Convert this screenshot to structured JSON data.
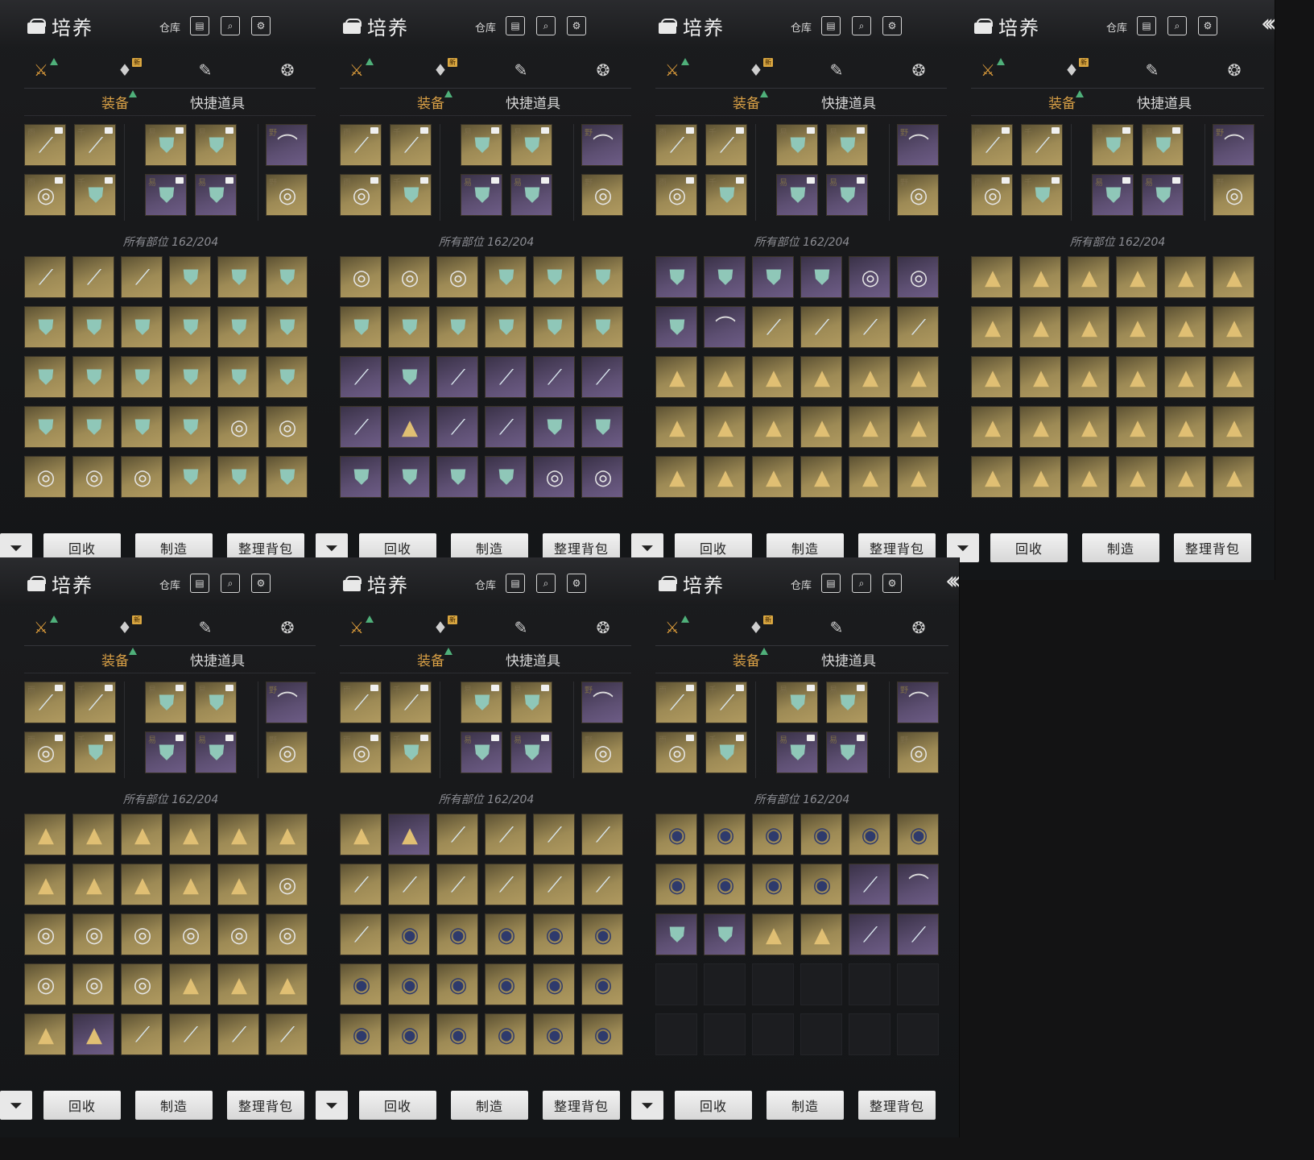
{
  "header": {
    "title": "培养",
    "warehouse_label": "仓库",
    "icons": [
      "bag-icon",
      "storage-icon",
      "search-icon",
      "settings-gear-icon",
      "back-arrow-icon"
    ]
  },
  "categories": [
    {
      "name": "equipment-category-icon",
      "glyph": "⚔",
      "active": true
    },
    {
      "name": "consumable-category-icon",
      "glyph": "♦",
      "badge": "新"
    },
    {
      "name": "scroll-category-icon",
      "glyph": "✎"
    },
    {
      "name": "misc-category-icon",
      "glyph": "❂"
    }
  ],
  "subtabs": {
    "equipment": "装备",
    "quick_items": "快捷道具"
  },
  "count_label": "所有部位 162/204",
  "bottom_bar": {
    "recycle": "回收",
    "craft": "制造",
    "organize": "整理背包"
  },
  "equipped": [
    {
      "type": "weapon",
      "quality": "gold",
      "char": "雨"
    },
    {
      "type": "weapon",
      "quality": "gold",
      "char": "千"
    },
    {
      "type": "armor",
      "quality": "gold",
      "char": "易"
    },
    {
      "type": "armor",
      "quality": "gold",
      "char": "易"
    },
    {
      "type": "bow",
      "quality": "purple",
      "char": "野"
    },
    {
      "type": "disc",
      "quality": "gold",
      "char": "雨"
    },
    {
      "type": "armor",
      "quality": "gold",
      "char": "千"
    },
    {
      "type": "armor",
      "quality": "purple",
      "char": "易"
    },
    {
      "type": "armor",
      "quality": "purple",
      "char": "易"
    },
    {
      "type": "disc",
      "quality": "gold",
      "char": "野"
    }
  ],
  "colors": {
    "accent": "#d9a046",
    "upgrade": "#4fb07a",
    "gold_slot": "#9d8a55",
    "purple_slot": "#5d4f72"
  },
  "panels": [
    {
      "id": "p1",
      "inventory": [
        "weapon:gold",
        "weapon:gold",
        "weapon:gold",
        "armor:gold",
        "armor:gold",
        "armor:gold",
        "armor:gold",
        "armor:gold",
        "armor:gold",
        "armor:gold",
        "armor:gold",
        "armor:gold",
        "armor:gold",
        "armor:gold",
        "armor:gold",
        "armor:gold",
        "armor:gold",
        "armor:gold",
        "armor:gold",
        "armor:gold",
        "armor:gold",
        "armor:gold",
        "disc:gold",
        "disc:gold",
        "disc:gold",
        "disc:gold",
        "disc:gold",
        "armor:gold",
        "armor:gold",
        "armor:gold"
      ]
    },
    {
      "id": "p2",
      "inventory": [
        "disc:gold",
        "disc:gold",
        "disc:gold",
        "armor:gold",
        "armor:gold",
        "armor:gold",
        "armor:gold",
        "armor:gold",
        "armor:gold",
        "armor:gold",
        "armor:gold",
        "armor:gold",
        "weapon:purple",
        "armor:purple",
        "weapon:purple",
        "weapon:purple",
        "weapon:purple",
        "weapon:purple",
        "weapon:purple",
        "gold:purple",
        "weapon:purple",
        "weapon:purple",
        "armor:purple",
        "armor:purple",
        "armor:purple",
        "armor:purple",
        "armor:purple",
        "armor:purple",
        "disc:purple",
        "disc:purple"
      ]
    },
    {
      "id": "p3",
      "inventory": [
        "armor:purple",
        "armor:purple",
        "armor:purple",
        "armor:purple",
        "disc:purple",
        "disc:purple",
        "armor:purple",
        "bow:purple",
        "weapon:gold",
        "weapon:gold",
        "weapon:gold",
        "weapon:gold",
        "gold:gold",
        "gold:gold",
        "gold:gold",
        "gold:gold",
        "gold:gold",
        "gold:gold",
        "gold:gold",
        "gold:gold",
        "gold:gold",
        "gold:gold",
        "gold:gold",
        "gold:gold",
        "gold:gold",
        "gold:gold",
        "gold:gold",
        "gold:gold",
        "gold:gold",
        "gold:gold"
      ]
    },
    {
      "id": "p4",
      "inventory": [
        "gold:gold",
        "gold:gold",
        "gold:gold",
        "gold:gold",
        "gold:gold",
        "gold:gold",
        "gold:gold",
        "gold:gold",
        "gold:gold",
        "gold:gold",
        "gold:gold",
        "gold:gold",
        "gold:gold",
        "gold:gold",
        "gold:gold",
        "gold:gold",
        "gold:gold",
        "gold:gold",
        "gold:gold",
        "gold:gold",
        "gold:gold",
        "gold:gold",
        "gold:gold",
        "gold:gold",
        "gold:gold",
        "gold:gold",
        "gold:gold",
        "gold:gold",
        "gold:gold",
        "gold:gold"
      ]
    },
    {
      "id": "p5",
      "inventory": [
        "gold:gold",
        "gold:gold",
        "gold:gold",
        "gold:gold",
        "gold:gold",
        "gold:gold",
        "gold:gold",
        "gold:gold",
        "gold:gold",
        "gold:gold",
        "gold:gold",
        "disc:gold",
        "disc:gold",
        "disc:gold",
        "disc:gold",
        "disc:gold",
        "disc:gold",
        "disc:gold",
        "disc:gold",
        "disc:gold",
        "disc:gold",
        "gold:gold",
        "gold:gold",
        "gold:gold",
        "gold:gold",
        "gold:purple",
        "weapon:gold",
        "weapon:gold",
        "weapon:gold",
        "weapon:gold"
      ]
    },
    {
      "id": "p6",
      "inventory": [
        "gold:gold",
        "gold:purple",
        "weapon:gold",
        "weapon:gold",
        "weapon:gold",
        "weapon:gold",
        "weapon:gold",
        "weapon:gold",
        "weapon:gold",
        "weapon:gold",
        "weapon:gold",
        "weapon:gold",
        "weapon:gold",
        "navy:gold",
        "navy:gold",
        "navy:gold",
        "navy:gold",
        "navy:gold",
        "navy:gold",
        "navy:gold",
        "navy:gold",
        "navy:gold",
        "navy:gold",
        "navy:gold",
        "navy:gold",
        "navy:gold",
        "navy:gold",
        "navy:gold",
        "navy:gold",
        "navy:gold"
      ]
    },
    {
      "id": "p7",
      "inventory": [
        "navy:gold",
        "navy:gold",
        "navy:gold",
        "navy:gold",
        "navy:gold",
        "navy:gold",
        "navy:gold",
        "navy:gold",
        "navy:gold",
        "navy:gold",
        "weapon:purple",
        "bow:purple",
        "armor:purple",
        "armor:purple",
        "gold:gold",
        "gold:gold",
        "weapon:purple",
        "weapon:purple",
        "empty",
        "empty",
        "empty",
        "empty",
        "empty",
        "empty",
        "empty",
        "empty",
        "empty",
        "empty",
        "empty",
        "empty"
      ]
    }
  ]
}
